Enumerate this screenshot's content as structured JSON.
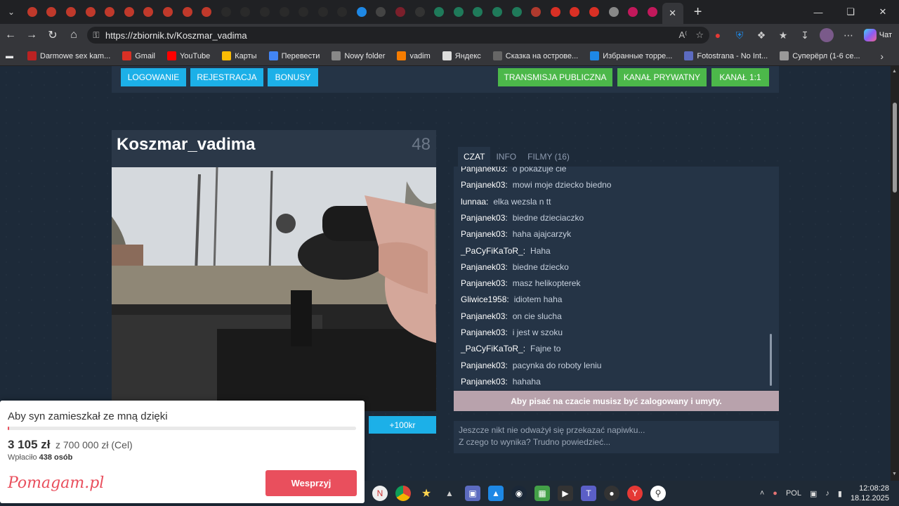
{
  "browser": {
    "url": "https://zbiornik.tv/Koszmar_vadima",
    "chat_button": "Чат",
    "tab_favicon_colors": [
      "#c0392b",
      "#c0392b",
      "#c0392b",
      "#c0392b",
      "#c0392b",
      "#c0392b",
      "#c0392b",
      "#c0392b",
      "#c0392b",
      "#c0392b",
      "#2a2a2a",
      "#2a2a2a",
      "#2a2a2a",
      "#2a2a2a",
      "#2a2a2a",
      "#2a2a2a",
      "#2a2a2a",
      "#1e88e5",
      "#444",
      "#7b1f2b",
      "#333",
      "#1f7a5a",
      "#1f7a5a",
      "#1f7a5a",
      "#1f7a5a",
      "#1f7a5a",
      "#b03a2e",
      "#d93025",
      "#d93025",
      "#d93025",
      "#888",
      "#c2185b",
      "#c2185b"
    ],
    "bookmarks": [
      {
        "label": "Darmowe sex kam...",
        "color": "#b22"
      },
      {
        "label": "Gmail",
        "color": "#d93025"
      },
      {
        "label": "YouTube",
        "color": "#ff0000"
      },
      {
        "label": "Карты",
        "color": "#fbbc04"
      },
      {
        "label": "Перевести",
        "color": "#4285f4"
      },
      {
        "label": "Nowy folder",
        "color": "#888"
      },
      {
        "label": "vadim",
        "color": "#f57c00"
      },
      {
        "label": "Яндекс",
        "color": "#ddd"
      },
      {
        "label": "Сказка на острове...",
        "color": "#666"
      },
      {
        "label": "Избранные торре...",
        "color": "#1e88e5"
      },
      {
        "label": "Fotostrana - No Int...",
        "color": "#5c6bc0"
      },
      {
        "label": "Суперёрл (1-6 се...",
        "color": "#999"
      }
    ]
  },
  "nav": {
    "login": "LOGOWANIE",
    "register": "REJESTRACJA",
    "bonus": "BONUSY",
    "public": "TRANSMISJA PUBLICZNA",
    "private": "KANAŁ PRYWATNY",
    "one_on_one": "KANAŁ 1:1"
  },
  "stream": {
    "title": "Koszmar_vadima",
    "viewers": "48",
    "tip_button": "+100kr"
  },
  "chat": {
    "tabs": [
      "CZAT",
      "INFO",
      "FILMY (16)"
    ],
    "messages": [
      {
        "user": "Panjanek03:",
        "text": "o pokazuje cie"
      },
      {
        "user": "Panjanek03:",
        "text": "mowi moje dziecko biedno"
      },
      {
        "user": "lunnaa:",
        "text": "elka wezsla n tt"
      },
      {
        "user": "Panjanek03:",
        "text": "biedne dzieciaczko"
      },
      {
        "user": "Panjanek03:",
        "text": "haha ajajcarzyk"
      },
      {
        "user": "_PaCyFiKaToR_:",
        "text": "Haha"
      },
      {
        "user": "Panjanek03:",
        "text": "biedne dziecko"
      },
      {
        "user": "Panjanek03:",
        "text": "masz helikopterek"
      },
      {
        "user": "Gliwice1958:",
        "text": "idiotem haha"
      },
      {
        "user": "Panjanek03:",
        "text": "on cie slucha"
      },
      {
        "user": "Panjanek03:",
        "text": "i jest w szoku"
      },
      {
        "user": "_PaCyFiKaToR_:",
        "text": "Fajne to"
      },
      {
        "user": "Panjanek03:",
        "text": "pacynka do roboty leniu"
      },
      {
        "user": "Panjanek03:",
        "text": "hahaha"
      }
    ],
    "notice": "Aby pisać na czacie musisz być zalogowany i umyty.",
    "tip_line1": "Jeszcze nikt nie odważył się przekazać napiwku...",
    "tip_line2": "Z czego to wynika? Trudno powiedzieć..."
  },
  "fundraiser": {
    "title": "Aby syn zamieszkał ze mną dzięki",
    "amount": "3 105 zł",
    "goal": "z 700 000 zł (Cel)",
    "paid_label": "Wpłaciło",
    "paid_count": "438 osób",
    "logo": "Pomagam.pl",
    "button": "Wesprzyj",
    "progress_percent": 0.44
  },
  "taskbar": {
    "lang": "POL",
    "time": "12:08:28",
    "date": "18.12.2025"
  }
}
